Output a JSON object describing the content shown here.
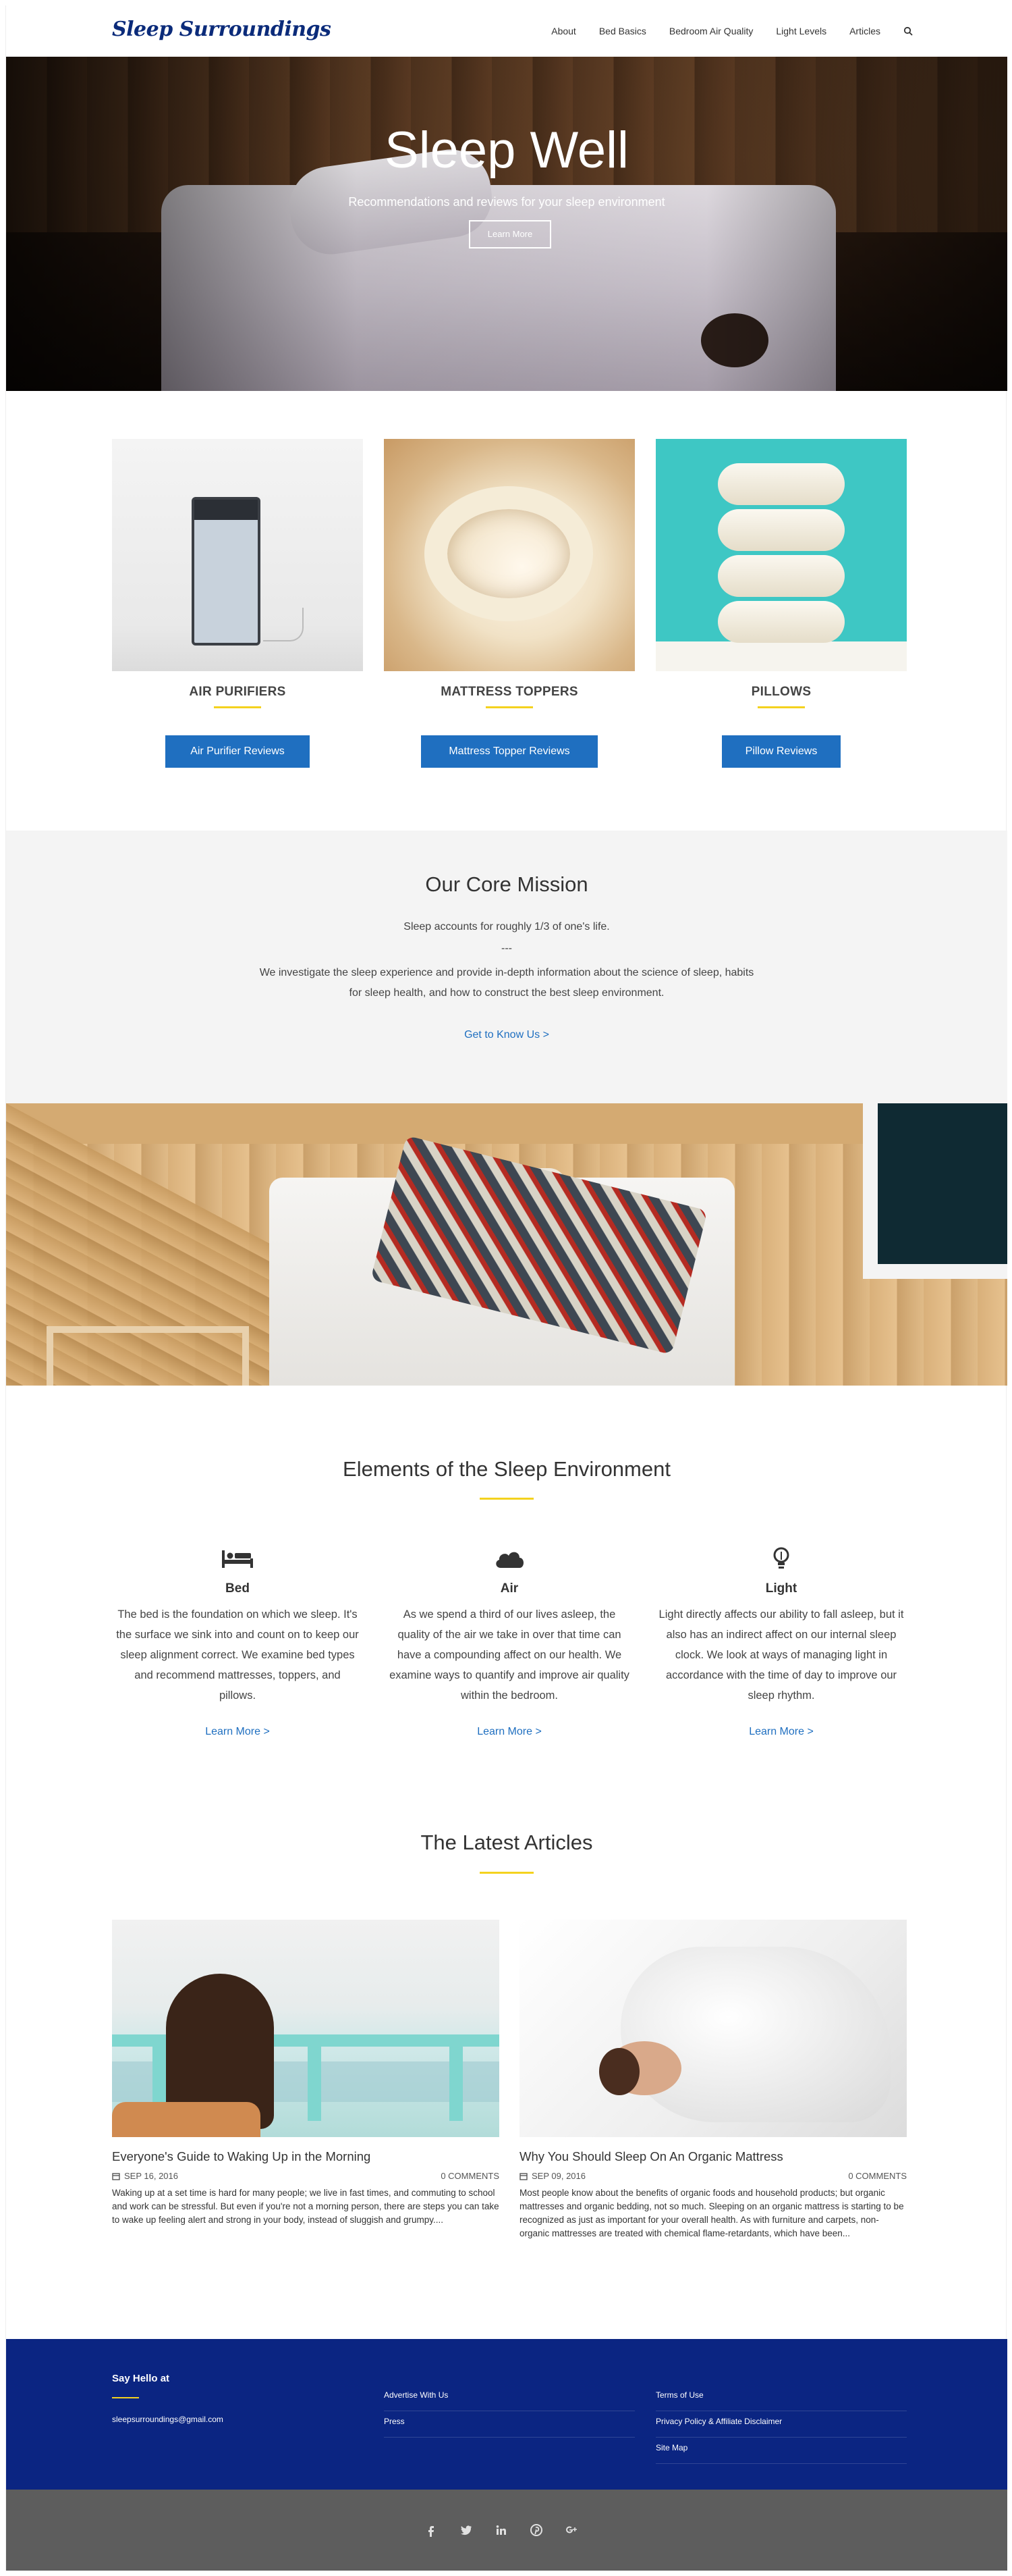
{
  "header": {
    "logo": "Sleep Surroundings",
    "nav": [
      "About",
      "Bed Basics",
      "Bedroom Air Quality",
      "Light Levels",
      "Articles"
    ],
    "search_icon": "search-icon"
  },
  "hero": {
    "title": "Sleep Well",
    "subtitle": "Recommendations and reviews for your sleep environment",
    "button": "Learn More"
  },
  "products": [
    {
      "name": "AIR PURIFIERS",
      "button": "Air Purifier Reviews"
    },
    {
      "name": "MATTRESS TOPPERS",
      "button": "Mattress Topper Reviews"
    },
    {
      "name": "PILLOWS",
      "button": "Pillow Reviews"
    }
  ],
  "mission": {
    "title": "Our Core Mission",
    "line1": "Sleep accounts for roughly 1/3 of one's life.",
    "dash": "---",
    "line2": "We investigate the sleep experience and provide in-depth information about the science of sleep, habits for sleep health, and how to construct the best sleep environment.",
    "link": "Get to Know Us >"
  },
  "elements": {
    "title": "Elements of the Sleep Environment",
    "items": [
      {
        "icon": "bed-icon",
        "title": "Bed",
        "text": "The bed is the foundation on which we sleep. It's the surface we sink into and count on to keep our sleep alignment correct. We examine bed types and recommend mattresses, toppers, and pillows.",
        "link": "Learn More >"
      },
      {
        "icon": "cloud-icon",
        "title": "Air",
        "text": "As we spend a third of our lives asleep, the quality of the air we take in over that time can have a compounding affect on our health. We examine ways to quantify and improve air quality within the bedroom.",
        "link": "Learn More >"
      },
      {
        "icon": "lightbulb-icon",
        "title": "Light",
        "text": "Light directly affects our ability to fall asleep, but it also has an indirect affect on our internal sleep clock. We look at ways of managing light in accordance with the time of day to improve our sleep rhythm.",
        "link": "Learn More >"
      }
    ]
  },
  "articles": {
    "title": "The Latest Articles",
    "items": [
      {
        "title": "Everyone's Guide to Waking Up in the Morning",
        "date": "SEP 16, 2016",
        "comments": "0 COMMENTS",
        "excerpt": "Waking up at a set time is hard for many people; we live in fast times, and commuting to school and work can be stressful. But even if you're not a morning person, there are steps you can take to wake up feeling alert and strong in your body, instead of sluggish and grumpy...."
      },
      {
        "title": "Why You Should Sleep On An Organic Mattress",
        "date": "SEP 09, 2016",
        "comments": "0 COMMENTS",
        "excerpt": "Most people know about the benefits of organic foods and household products; but organic mattresses and organic bedding, not so much. Sleeping on an organic mattress is starting to be recognized as just as important for your overall health. As with furniture and carpets, non-organic mattresses are treated with chemical flame-retardants, which have been..."
      }
    ]
  },
  "footer": {
    "hello": "Say Hello at",
    "email": "sleepsurroundings@gmail.com",
    "col1": [
      "Advertise With Us",
      "Press"
    ],
    "col2": [
      "Terms of Use",
      "Privacy Policy & Affiliate Disclaimer",
      "Site Map"
    ],
    "social_icons": [
      "facebook-icon",
      "twitter-icon",
      "linkedin-icon",
      "pinterest-icon",
      "google-plus-icon"
    ]
  }
}
